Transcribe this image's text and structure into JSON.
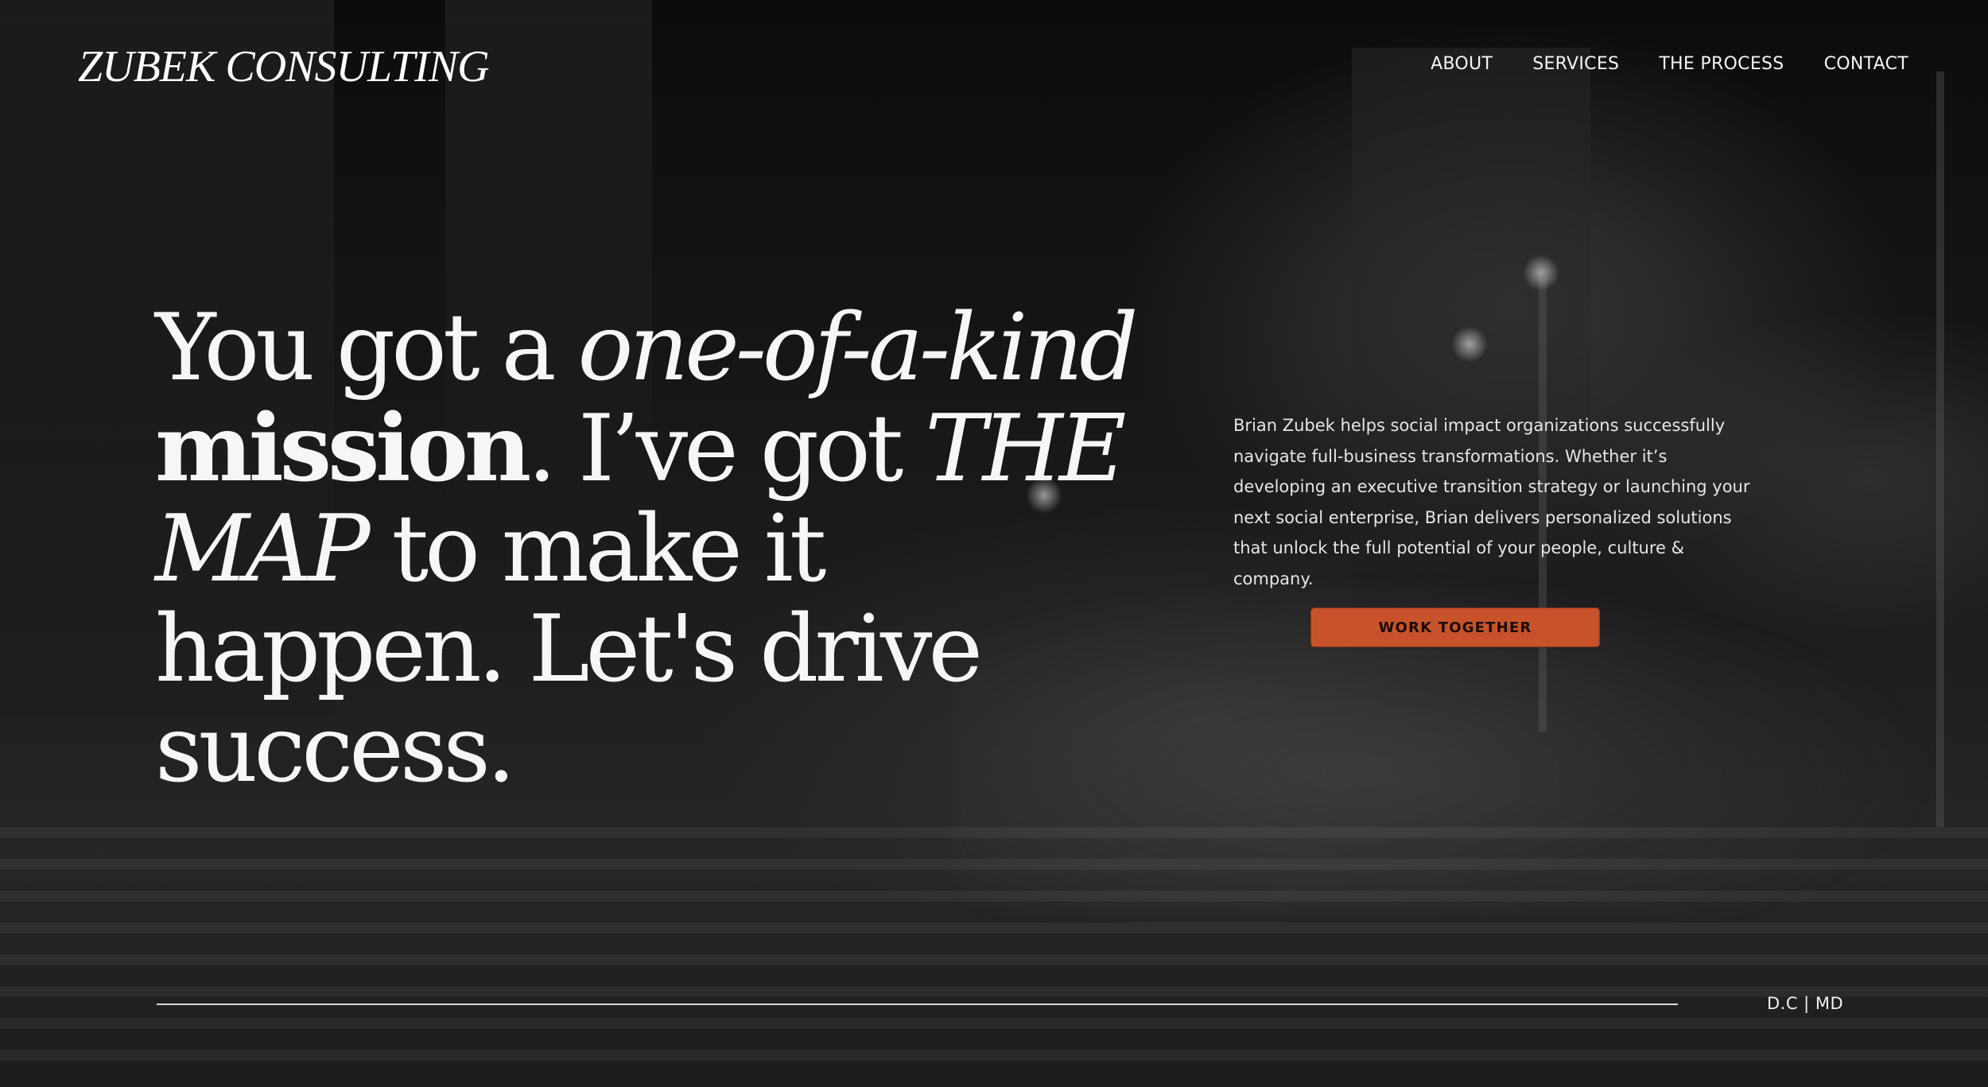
{
  "header": {
    "logo": "ZUBEK CONSULTING",
    "nav": [
      {
        "label": "ABOUT"
      },
      {
        "label": "SERVICES"
      },
      {
        "label": "THE PROCESS"
      },
      {
        "label": "CONTACT"
      }
    ]
  },
  "hero": {
    "headline": {
      "p1": "You got a ",
      "p2_italic": "one-of-a-kind",
      "p3_bold": "mission",
      "p4": ". I’ve got ",
      "p5_italic": "THE MAP",
      "p6": " to make it happen. Let's drive success."
    },
    "description": "Brian Zubek helps social impact organizations successfully navigate full-business transformations. Whether it’s developing an executive transition strategy or launching your next social enterprise, Brian delivers personalized solutions that unlock the full potential of your people, culture & company.",
    "cta_label": "WORK TOGETHER"
  },
  "footer": {
    "location": "D.C | MD"
  },
  "colors": {
    "accent": "#c8532a",
    "background": "#141414",
    "text": "#f6f6f6"
  }
}
